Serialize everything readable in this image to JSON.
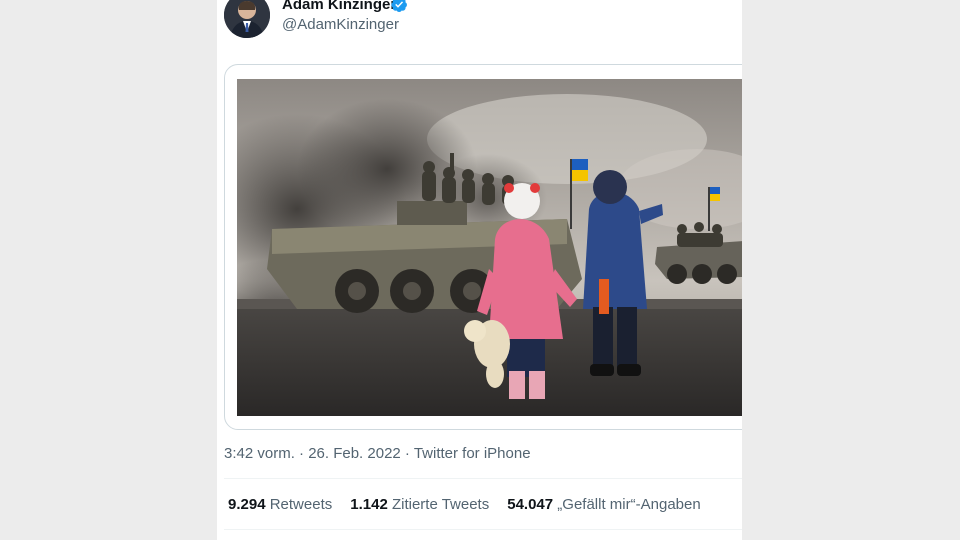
{
  "tweet": {
    "author_name": "Adam Kinzinger",
    "author_handle": "@AdamKinzinger",
    "verified_icon": "verified-badge-icon",
    "timestamp": "3:42 vorm. · 26. Feb. 2022 · Twitter for iPhone",
    "stats": {
      "retweets_count": "9.294",
      "retweets_label": "Retweets",
      "quotes_count": "1.142",
      "quotes_label": "Zitierte Tweets",
      "likes_count": "54.047",
      "likes_label": "„Gefällt mir“-Angaben"
    }
  },
  "colors": {
    "accent": "#1d9bf0",
    "text_primary": "#0f1419",
    "text_secondary": "#536471",
    "flag_blue": "#1d5fbf",
    "flag_yellow": "#f5c400"
  }
}
